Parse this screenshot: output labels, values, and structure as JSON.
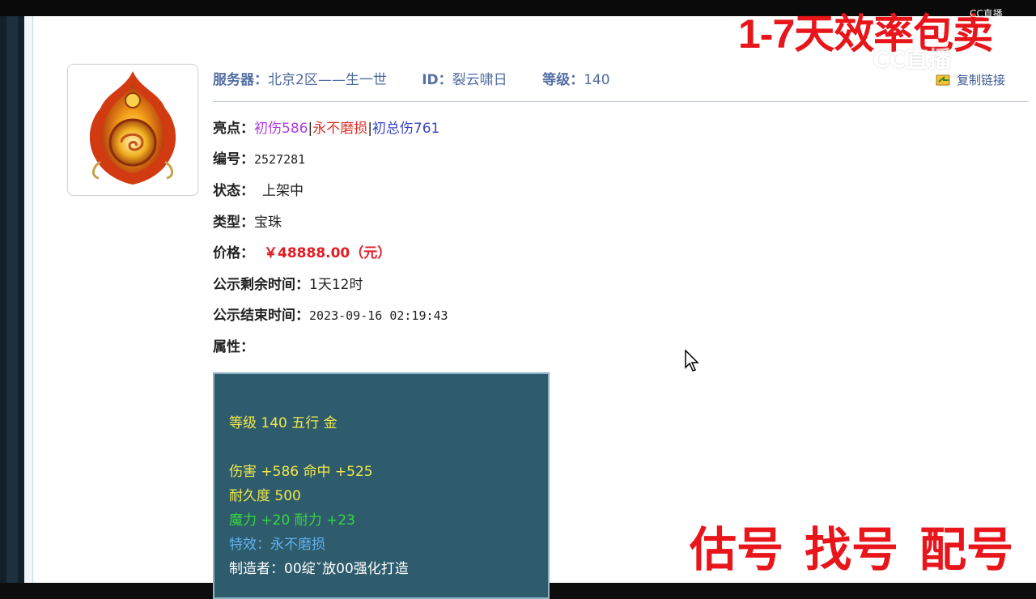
{
  "header": {
    "server_label": "服务器：",
    "server_value": "北京2区——生一世",
    "id_label": "ID：",
    "id_value": "裂云啸日",
    "level_label": "等级：",
    "level_value": "140",
    "copy_link": "复制链接"
  },
  "details": {
    "highlights_label": "亮点：",
    "highlight_1": "初伤586",
    "sep1": "|",
    "highlight_2": "永不磨损",
    "sep2": "|",
    "highlight_3": "初总伤761",
    "number_label": "编号：",
    "number_value": "2527281",
    "status_label": "状态：",
    "status_value": "上架中",
    "type_label": "类型：",
    "type_value": "宝珠",
    "price_label": "价格：",
    "price_value": "￥48888.00（元）",
    "remaining_label": "公示剩余时间：",
    "remaining_value": "1天12时",
    "end_label": "公示结束时间：",
    "end_value": "2023-09-16 02:19:43",
    "attr_label": "属性："
  },
  "attributes": {
    "line1": "等级 140 五行 金",
    "line2": "伤害 +586 命中 +525",
    "line3": "耐久度 500",
    "line4": "魔力 +20 耐力 +23",
    "line5": "特效：永不磨损",
    "line6": "制造者：00绽ˇ放00强化打造"
  },
  "overlay": {
    "top_banner": "1-7天效率包卖",
    "bottom_1": "估号",
    "bottom_2": "找号",
    "bottom_3": "配号",
    "watermark_small": "CC直播",
    "watermark_big": "CC直播"
  },
  "colors": {
    "price": "#e21b22",
    "attr_box_bg": "#2f5c6d",
    "overlay_red": "#e8151b"
  }
}
